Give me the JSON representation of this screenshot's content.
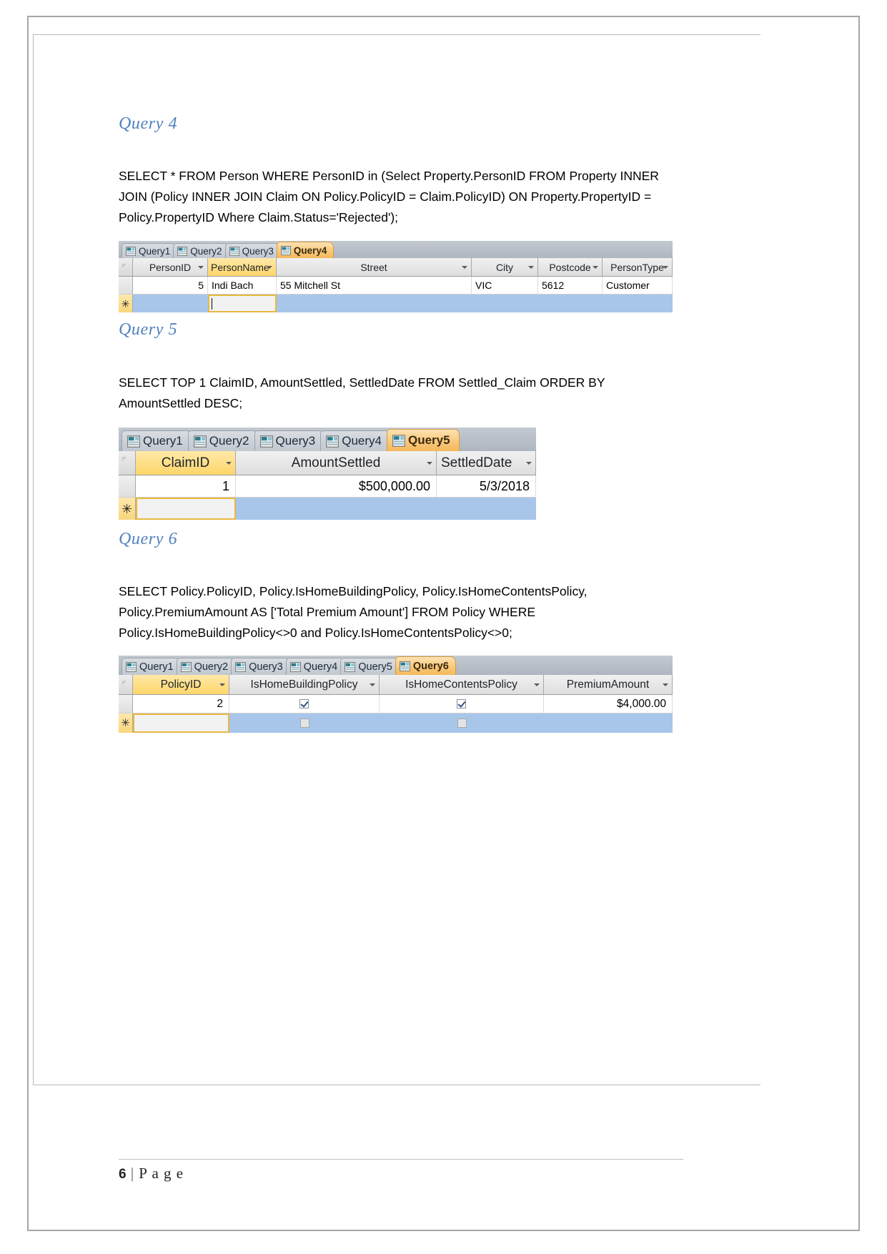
{
  "document": {
    "footer": {
      "page_number": "6",
      "separator": "|",
      "page_word": "P a g e"
    }
  },
  "sections": [
    {
      "heading": "Query 4",
      "sql": "SELECT * FROM Person WHERE PersonID in (Select Property.PersonID FROM Property INNER JOIN (Policy INNER JOIN Claim ON Policy.PolicyID = Claim.PolicyID) ON Property.PropertyID = Policy.PropertyID Where Claim.Status='Rejected');"
    },
    {
      "heading": "Query 5",
      "sql": "SELECT TOP 1 ClaimID, AmountSettled, SettledDate FROM Settled_Claim ORDER BY AmountSettled DESC;"
    },
    {
      "heading": "Query 6",
      "sql": "SELECT Policy.PolicyID, Policy.IsHomeBuildingPolicy, Policy.IsHomeContentsPolicy, Policy.PremiumAmount AS ['Total Premium Amount'] FROM Policy WHERE Policy.IsHomeBuildingPolicy<>0 and Policy.IsHomeContentsPolicy<>0;"
    }
  ],
  "datasheets": {
    "query4": {
      "tabs": [
        "Query1",
        "Query2",
        "Query3",
        "Query4"
      ],
      "active_tab": "Query4",
      "columns": [
        "PersonID",
        "PersonName",
        "Street",
        "City",
        "Postcode",
        "PersonType"
      ],
      "selected_column": "PersonName",
      "rows": [
        [
          "5",
          "Indi Bach",
          "55 Mitchell St",
          "VIC",
          "5612",
          "Customer"
        ]
      ],
      "new_record_marker": "✳"
    },
    "query5": {
      "tabs": [
        "Query1",
        "Query2",
        "Query3",
        "Query4",
        "Query5"
      ],
      "active_tab": "Query5",
      "columns": [
        "ClaimID",
        "AmountSettled",
        "SettledDate"
      ],
      "selected_column": "ClaimID",
      "rows": [
        [
          "1",
          "$500,000.00",
          "5/3/2018"
        ]
      ],
      "new_record_marker": "✳"
    },
    "query6": {
      "tabs": [
        "Query1",
        "Query2",
        "Query3",
        "Query4",
        "Query5",
        "Query6"
      ],
      "active_tab": "Query6",
      "columns": [
        "PolicyID",
        "IsHomeBuildingPolicy",
        "IsHomeContentsPolicy",
        "PremiumAmount"
      ],
      "selected_column": "PolicyID",
      "rows": [
        [
          "2",
          "checked",
          "checked",
          "$4,000.00"
        ]
      ],
      "new_record_marker": "✳"
    }
  },
  "colors": {
    "heading": "#4f81bd",
    "tab_active": "#f5b85c",
    "selected_header": "#fdd66a",
    "new_row": "#a8c6ea"
  }
}
